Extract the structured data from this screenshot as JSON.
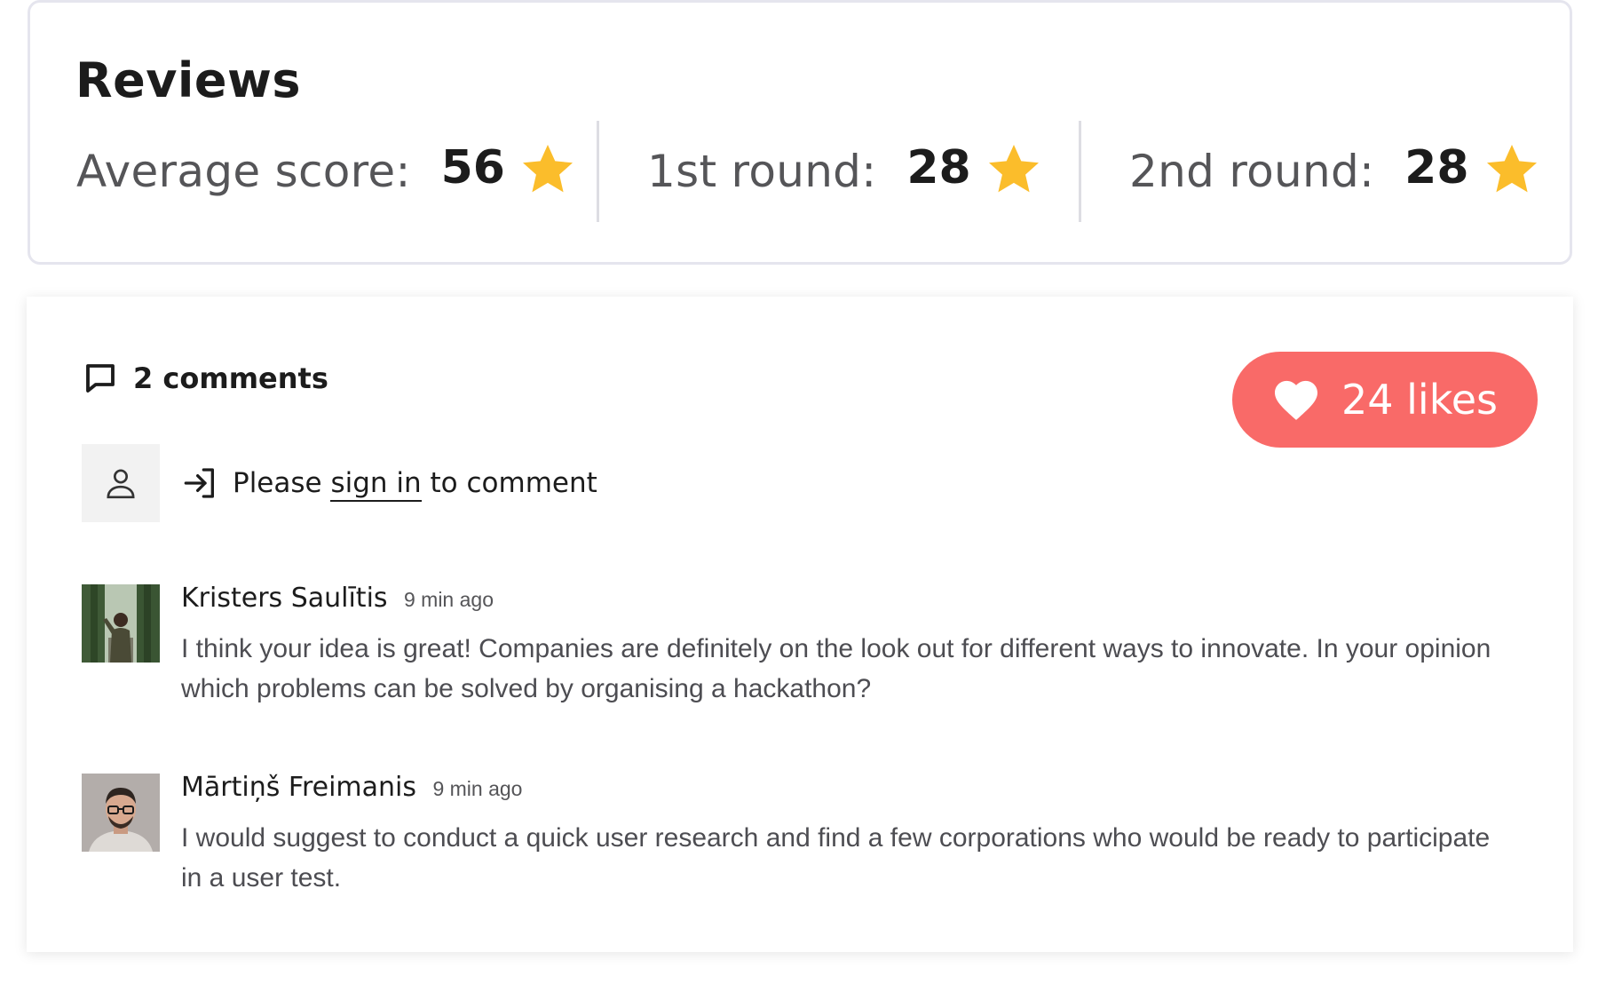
{
  "reviews": {
    "title": "Reviews",
    "scores": [
      {
        "label": "Average score:",
        "value": "56"
      },
      {
        "label": "1st round:",
        "value": "28"
      },
      {
        "label": "2nd round:",
        "value": "28"
      }
    ],
    "star_color": "#fbbd2b"
  },
  "comments": {
    "count_label": "2 comments",
    "likes_label": "24 likes",
    "likes_color": "#f96a68",
    "signin": {
      "prefix": "Please",
      "link": "sign in",
      "suffix": "to comment"
    },
    "items": [
      {
        "author": "Kristers Saulītis",
        "time": "9 min ago",
        "text": "I think your idea is great! Companies are definitely on the look out for different ways to innovate. In your opinion which problems can be solved by organising a hackathon?",
        "avatar": "user-photo-outdoors"
      },
      {
        "author": "Mārtiņš Freimanis",
        "time": "9 min ago",
        "text": "I would suggest to conduct a quick user research and find a few corporations who would be ready to participate in a user test.",
        "avatar": "user-photo-portrait"
      }
    ]
  }
}
